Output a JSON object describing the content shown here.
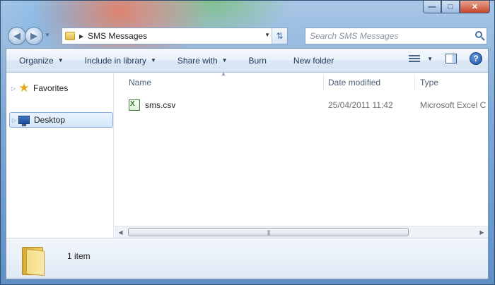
{
  "address": {
    "path": "SMS Messages"
  },
  "search": {
    "placeholder": "Search SMS Messages"
  },
  "toolbar": {
    "organize": "Organize",
    "include_in_library": "Include in library",
    "share_with": "Share with",
    "burn": "Burn",
    "new_folder": "New folder"
  },
  "navpane": {
    "favorites": "Favorites",
    "desktop": "Desktop"
  },
  "columns": {
    "name": "Name",
    "date_modified": "Date modified",
    "type": "Type"
  },
  "files": [
    {
      "name": "sms.csv",
      "date_modified": "25/04/2011 11:42",
      "type": "Microsoft Excel C"
    }
  ],
  "details": {
    "item_count": "1 item"
  },
  "colors": {
    "accent": "#1e395b",
    "selection": "#d3e6fb"
  },
  "icons": [
    "back-icon",
    "forward-icon",
    "folder-icon",
    "refresh-icon",
    "search-icon",
    "views-icon",
    "preview-pane-icon",
    "help-icon",
    "star-icon",
    "desktop-icon",
    "excel-file-icon"
  ]
}
